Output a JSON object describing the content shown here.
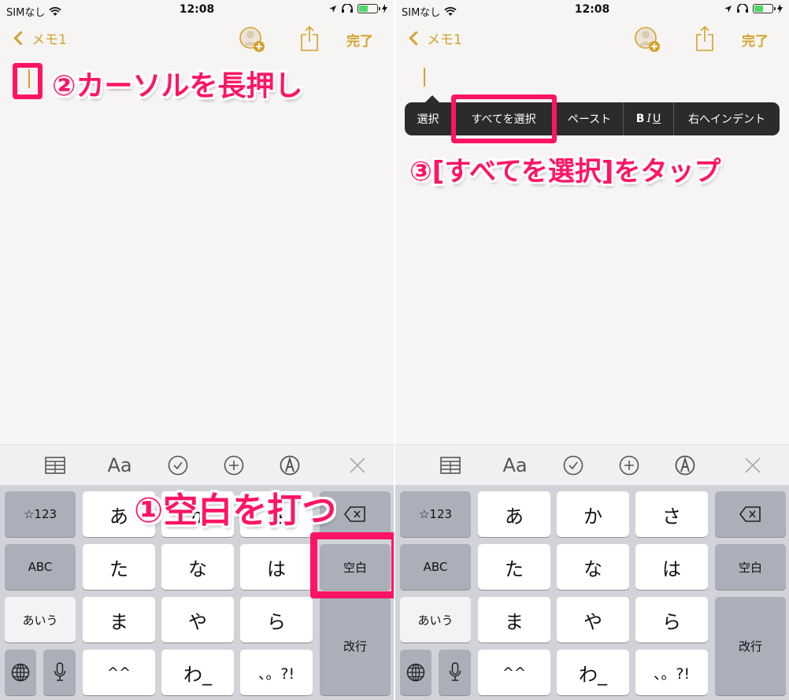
{
  "status_bar": {
    "carrier": "SIMなし",
    "time": "12:08"
  },
  "nav": {
    "back_label": "メモ1",
    "done_label": "完了"
  },
  "edit_menu": {
    "items": [
      "選択",
      "すべてを選択",
      "ペースト",
      "BIU",
      "右へインデント"
    ],
    "biu": {
      "b": "B",
      "i": "I",
      "u": "U"
    }
  },
  "toolbar": {
    "icons": [
      "table-icon",
      "text-format-icon",
      "checklist-icon",
      "add-icon",
      "markup-icon",
      "close-icon"
    ],
    "text_format_label": "Aa"
  },
  "keyboard": {
    "row1": [
      "☆123",
      "あ",
      "か",
      "さ"
    ],
    "row2": [
      "ABC",
      "た",
      "な",
      "は",
      "空白"
    ],
    "row3": [
      "あいう",
      "ま",
      "や",
      "ら",
      "改行"
    ],
    "row4": [
      "^^",
      "わ_",
      "、。?!"
    ]
  },
  "annotations": {
    "step1": "①空白を打つ",
    "step2": "②カーソルを長押し",
    "step3": "③[すべてを選択]をタップ"
  },
  "colors": {
    "accent": "#d4a22e",
    "highlight": "#ff1463",
    "menu_bg": "#2b2b2b"
  }
}
